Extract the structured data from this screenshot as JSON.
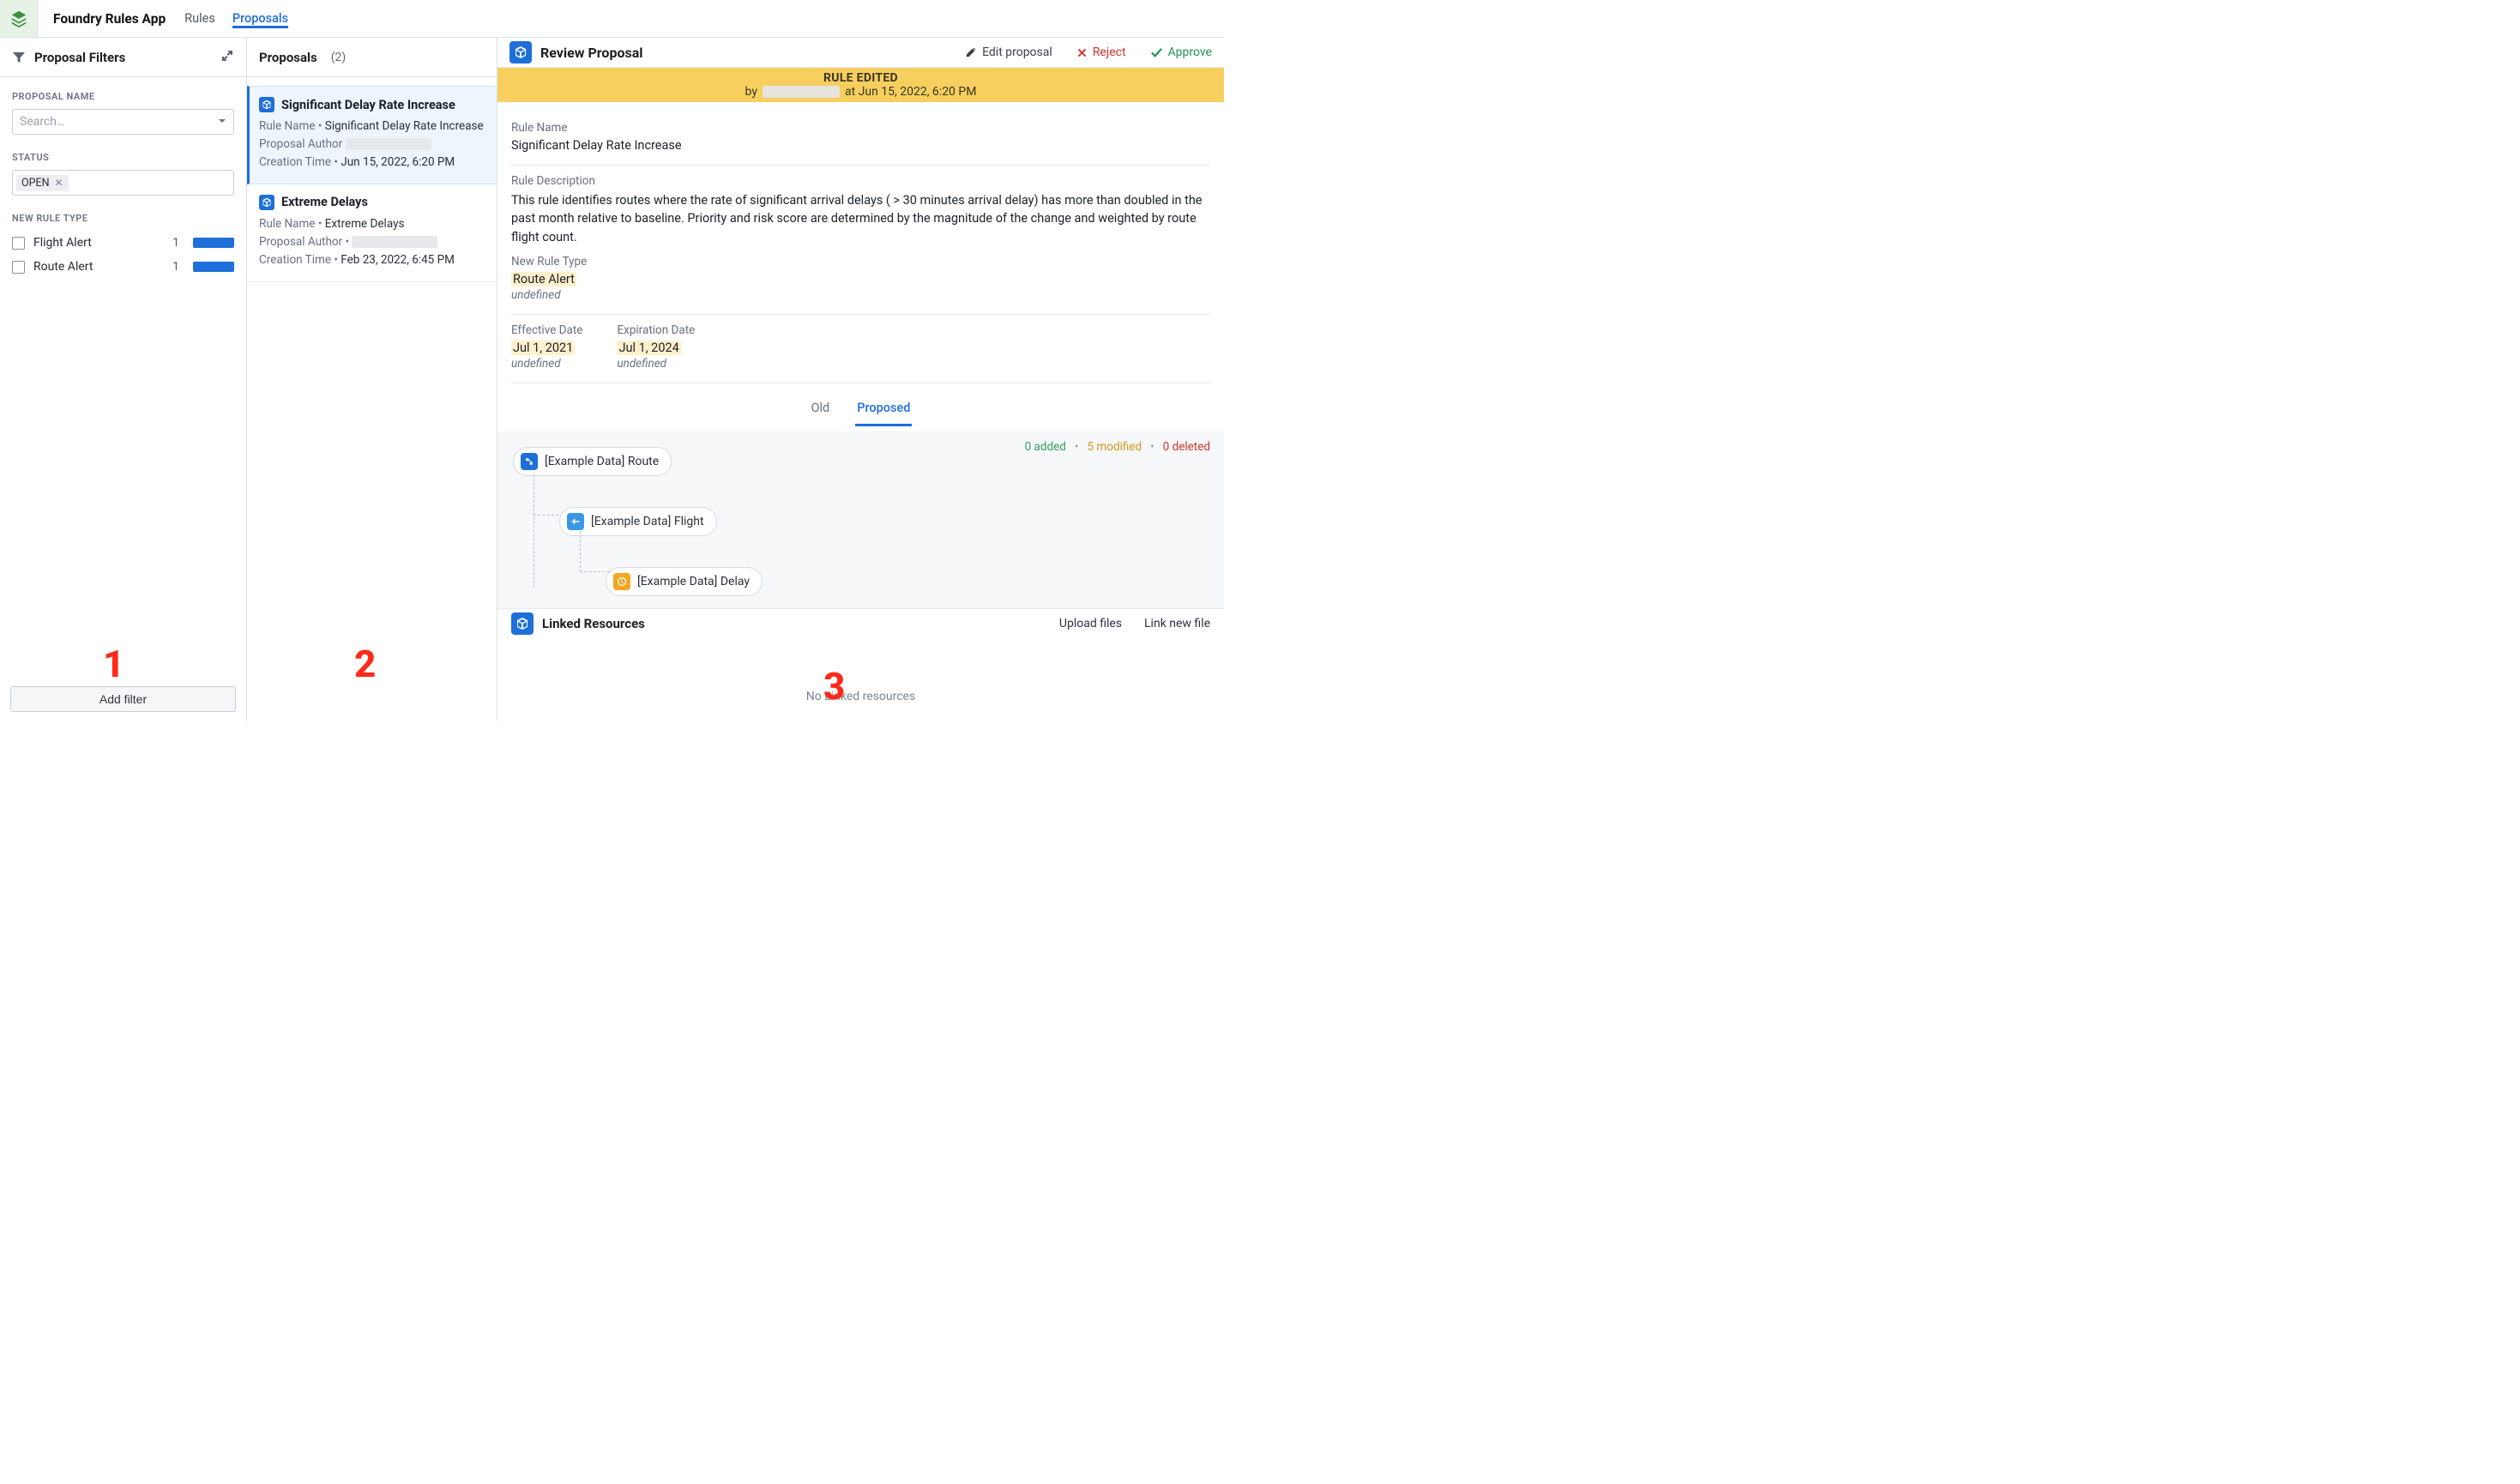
{
  "app": {
    "title": "Foundry Rules App",
    "tabs": {
      "rules": "Rules",
      "proposals": "Proposals"
    }
  },
  "filters": {
    "panel_title": "Proposal Filters",
    "proposal_name": {
      "label": "PROPOSAL NAME",
      "placeholder": "Search…"
    },
    "status": {
      "label": "STATUS",
      "chip": "OPEN"
    },
    "rule_type": {
      "label": "NEW RULE TYPE",
      "items": [
        {
          "name": "Flight Alert",
          "count": "1"
        },
        {
          "name": "Route Alert",
          "count": "1"
        }
      ]
    },
    "add_filter": "Add filter"
  },
  "list": {
    "title": "Proposals",
    "count": "(2)",
    "items": [
      {
        "title": "Significant Delay Rate Increase",
        "rule_name_label": "Rule Name",
        "rule_name": "Significant Delay Rate Increase",
        "author_label": "Proposal Author",
        "time_label": "Creation Time",
        "time": "Jun 15, 2022, 6:20 PM"
      },
      {
        "title": "Extreme Delays",
        "rule_name_label": "Rule Name",
        "rule_name": "Extreme Delays",
        "author_label": "Proposal Author",
        "time_label": "Creation Time",
        "time": "Feb 23, 2022, 6:45 PM"
      }
    ]
  },
  "review": {
    "title": "Review Proposal",
    "actions": {
      "edit": "Edit proposal",
      "reject": "Reject",
      "approve": "Approve"
    },
    "banner": {
      "line1": "RULE EDITED",
      "by": "by",
      "at_time": "at Jun 15, 2022, 6:20 PM"
    },
    "rule_name": {
      "label": "Rule Name",
      "value": "Significant Delay Rate Increase"
    },
    "rule_desc": {
      "label": "Rule Description",
      "value": "This rule identifies routes where the rate of significant arrival delays ( > 30 minutes arrival delay) has more than doubled in the past month relative to baseline. Priority and risk score are determined by the magnitude of the change and weighted by route flight count."
    },
    "new_rule_type": {
      "label": "New Rule Type",
      "value": "Route Alert",
      "undef": "undefined"
    },
    "effective": {
      "label": "Effective Date",
      "value": "Jul 1, 2021",
      "undef": "undefined"
    },
    "expiration": {
      "label": "Expiration Date",
      "value": "Jul 1, 2024",
      "undef": "undefined"
    },
    "subtabs": {
      "old": "Old",
      "proposed": "Proposed"
    },
    "diff": {
      "added": "0 added",
      "modified": "5 modified",
      "deleted": "0 deleted"
    },
    "tree": {
      "n1": "[Example Data] Route",
      "n2": "[Example Data] Flight",
      "n3": "[Example Data] Delay"
    },
    "linked": {
      "title": "Linked Resources",
      "upload": "Upload files",
      "link_new": "Link new file",
      "empty": "No Linked resources"
    }
  },
  "overlay_numbers": {
    "one": "1",
    "two": "2",
    "three": "3"
  }
}
